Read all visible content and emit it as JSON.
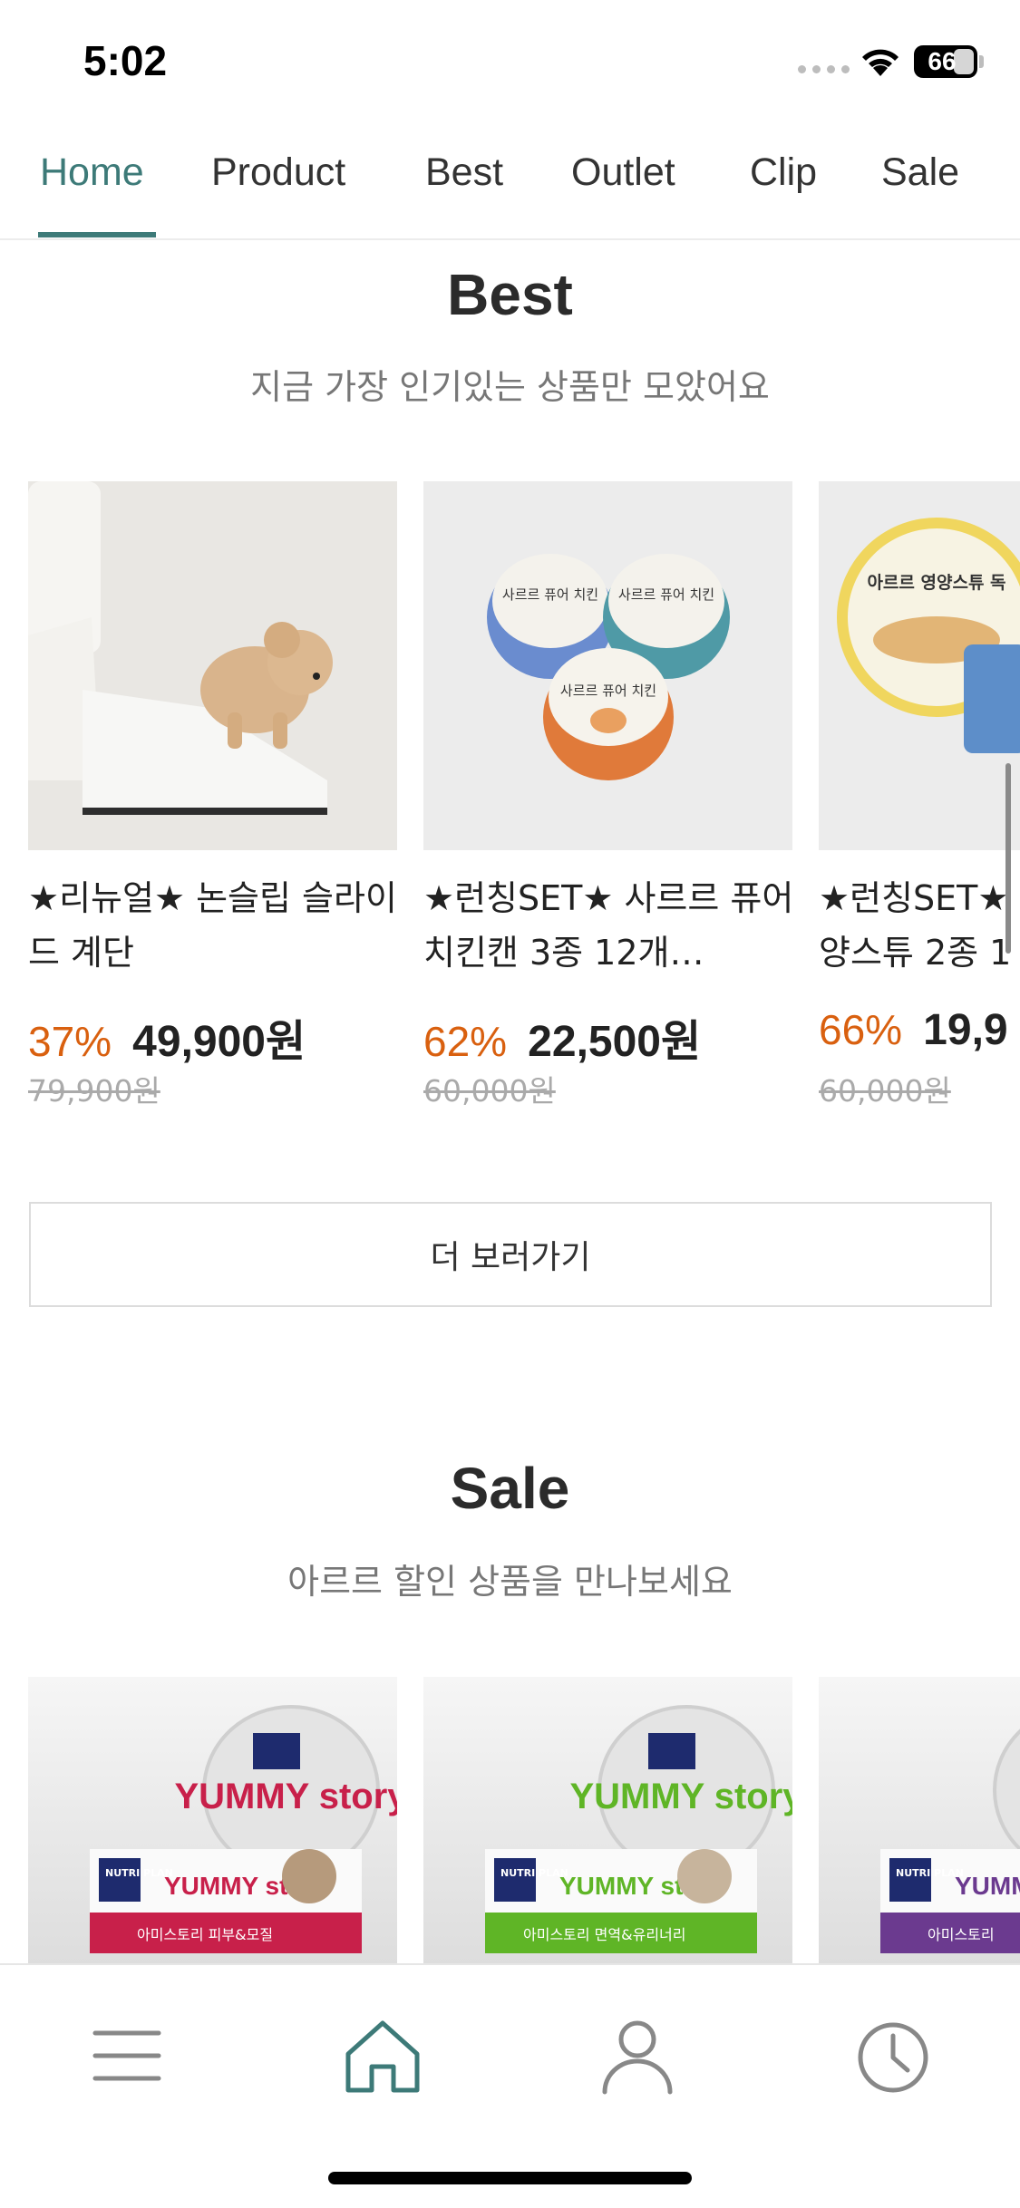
{
  "status": {
    "time": "5:02",
    "battery": "66"
  },
  "nav": {
    "tabs": [
      {
        "label": "Home",
        "active": true
      },
      {
        "label": "Product"
      },
      {
        "label": "Best"
      },
      {
        "label": "Outlet"
      },
      {
        "label": "Clip"
      },
      {
        "label": "Sale"
      }
    ]
  },
  "best": {
    "title": "Best",
    "subtitle": "지금 가장 인기있는 상품만 모았어요",
    "products": [
      {
        "name": "★리뉴얼★ 논슬립 슬라이드 계단",
        "discount": "37%",
        "price": "49,900원",
        "original": "79,900원"
      },
      {
        "name": "★런칭SET★ 사르르 퓨어 치킨캔 3종 12개…",
        "discount": "62%",
        "price": "22,500원",
        "original": "60,000원"
      },
      {
        "name": "★런칭SET★ 양스튜 2종 1",
        "discount": "66%",
        "price": "19,9",
        "original": "60,000원"
      }
    ],
    "more_label": "더 보러가기"
  },
  "sale": {
    "title": "Sale",
    "subtitle": "아르르 할인 상품을 만나보세요",
    "products": [
      {
        "brand": "NUTRI PLAN",
        "line": "YUMMY story",
        "variant": "아미스토리 피부&모질",
        "accent": "#c8204a"
      },
      {
        "brand": "NUTRI PLAN",
        "line": "YUMMY story",
        "variant": "아미스토리 면역&유리너리",
        "accent": "#5fb526"
      },
      {
        "brand": "NUTRI PLAN",
        "line": "YUMMY story",
        "variant": "아미스토리",
        "accent": "#6b3a8f"
      }
    ]
  },
  "product_images": {
    "can_label": "사르르 퓨어 치킨",
    "stew_label": "아르르 영양스튜 독"
  },
  "bottom_nav": {
    "items": [
      "menu-icon",
      "home-icon",
      "profile-icon",
      "history-icon"
    ]
  },
  "colors": {
    "accent": "#3d7a78",
    "discount": "#d9600f"
  }
}
